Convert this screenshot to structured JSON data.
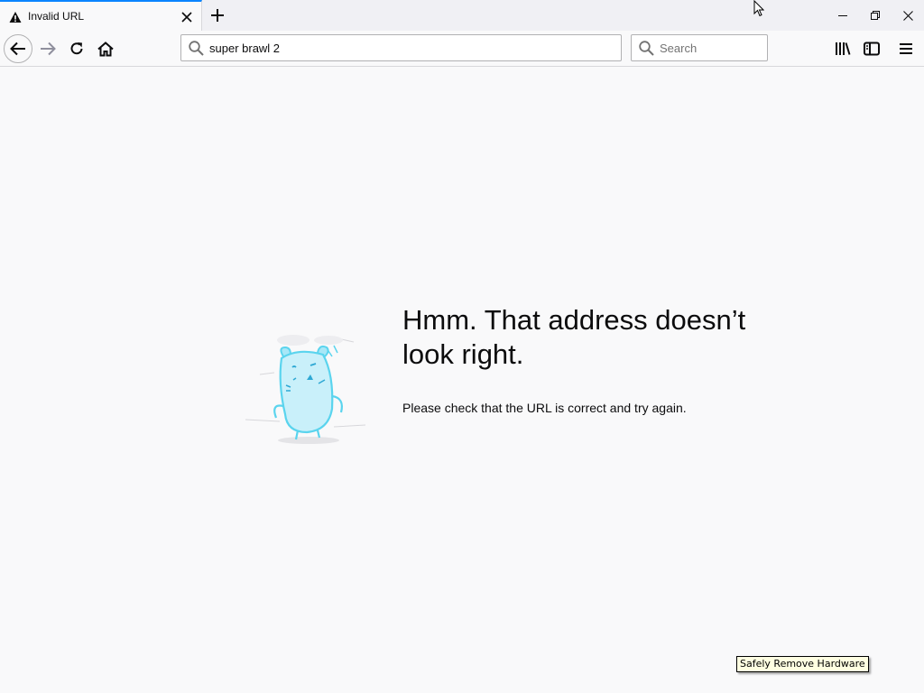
{
  "tab": {
    "title": "Invalid URL",
    "icon": "warning-icon"
  },
  "toolbar": {
    "back_icon": "back-arrow-icon",
    "forward_icon": "forward-arrow-icon",
    "reload_icon": "reload-icon",
    "home_icon": "home-icon",
    "library_icon": "library-icon",
    "sidebar_icon": "sidebar-icon",
    "menu_icon": "hamburger-menu-icon"
  },
  "urlbar": {
    "value": "super brawl 2"
  },
  "searchbar": {
    "placeholder": "Search",
    "value": ""
  },
  "error": {
    "title": "Hmm. That address doesn’t look right.",
    "description": "Please check that the URL is correct and try again."
  },
  "tooltip": {
    "text": "Safely Remove Hardware"
  },
  "colors": {
    "accent": "#0a84ff",
    "page_background": "#f9f9fa",
    "illustration": "#5ad4ee"
  }
}
